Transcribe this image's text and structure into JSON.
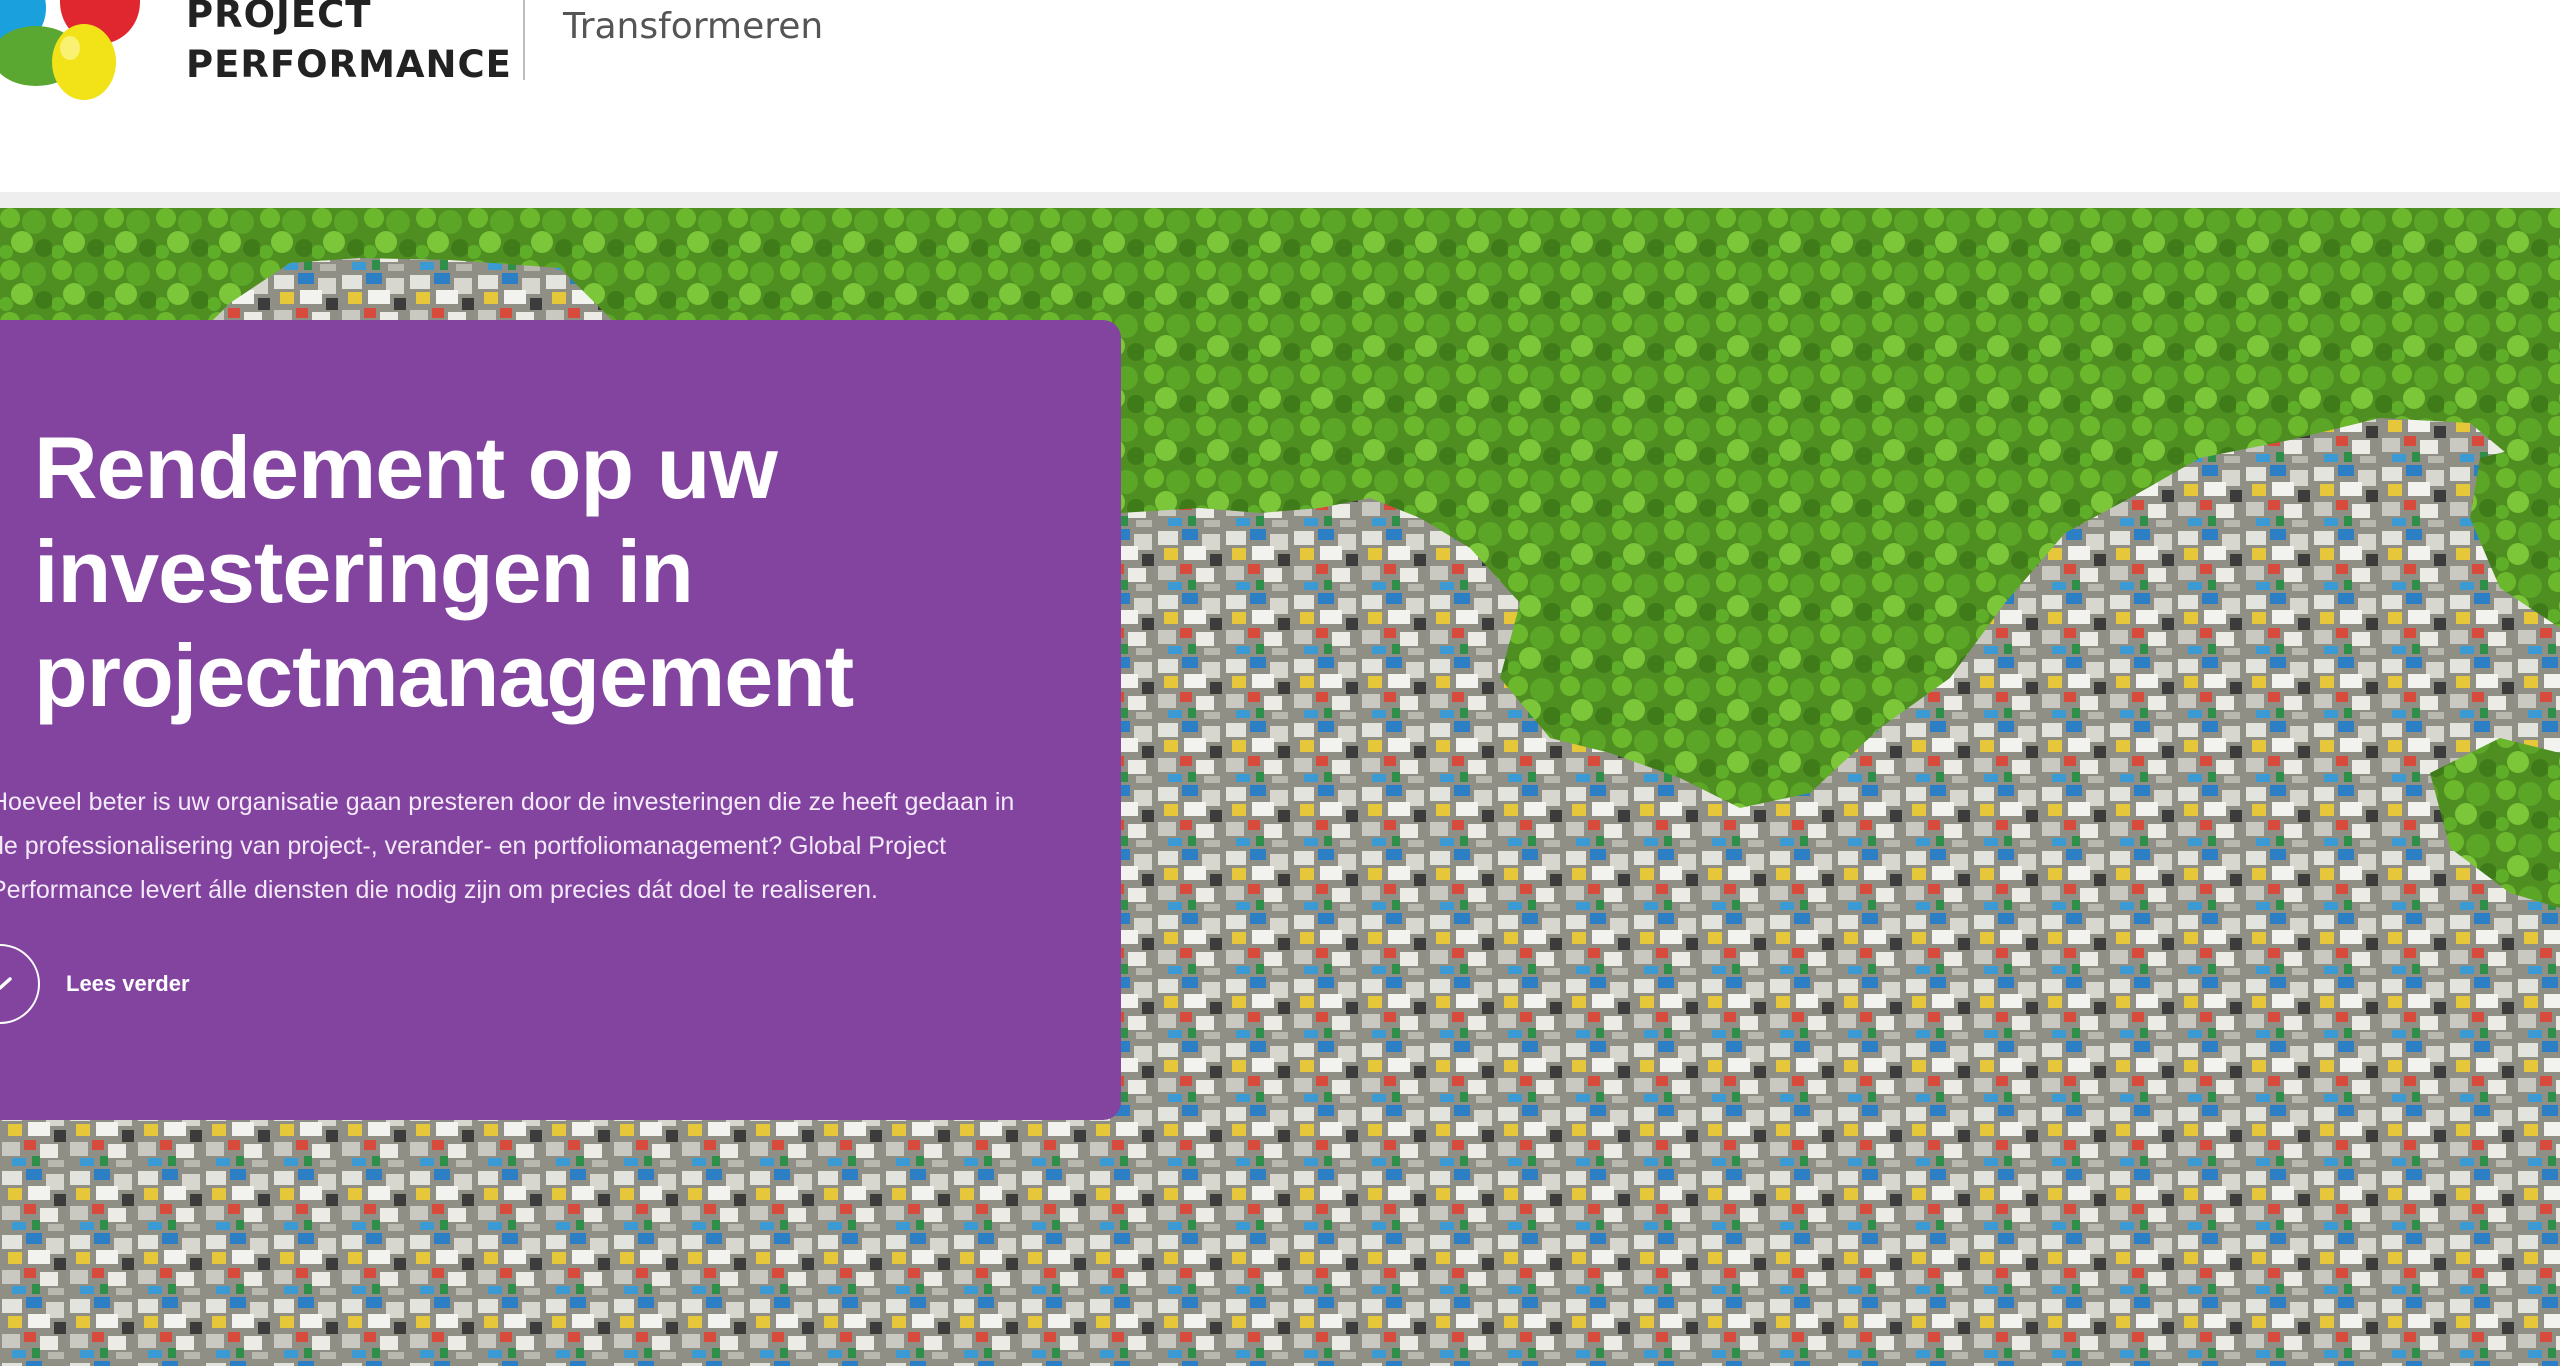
{
  "header": {
    "brand_line1": "PROJECT",
    "brand_line2": "PERFORMANCE",
    "tagline": "Transformeren",
    "logo_colors": {
      "blue": "#1aa0dc",
      "red": "#e0262f",
      "green": "#5aa832",
      "yellow": "#f2e218"
    }
  },
  "hero": {
    "title": "Rendement op uw investeringen in projectmanagement",
    "body": "Hoeveel beter is uw organisatie gaan presteren door de investeringen die ze heeft gedaan in de professionalisering van project-, verander- en portfoliomanagement? Global Project Performance levert álle diensten die nodig zijn om precies dát doel te realiseren.",
    "read_more_label": "Lees verder",
    "read_more_icon": "chevron-down-icon",
    "card_color": "#8344a0"
  }
}
